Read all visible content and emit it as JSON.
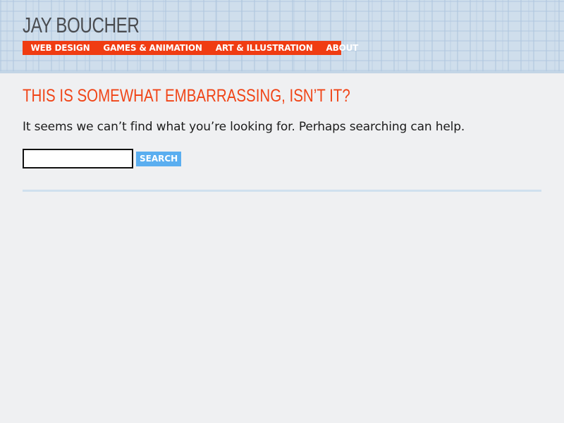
{
  "site": {
    "title": "JAY BOUCHER"
  },
  "nav": {
    "items": [
      {
        "label": "WEB DESIGN"
      },
      {
        "label": "GAMES & ANIMATION"
      },
      {
        "label": "ART & ILLUSTRATION"
      },
      {
        "label": "ABOUT"
      }
    ]
  },
  "main": {
    "heading": "THIS IS SOMEWHAT EMBARRASSING, ISN’T IT?",
    "message": "It seems we can’t find what you’re looking for. Perhaps searching can help."
  },
  "search": {
    "value": "",
    "placeholder": "",
    "button_label": "SEARCH"
  },
  "colors": {
    "accent": "#f03c12",
    "heading": "#f04518",
    "search_button": "#5aaef0",
    "header_bg": "#cfdeec",
    "page_bg": "#eff0f2"
  }
}
